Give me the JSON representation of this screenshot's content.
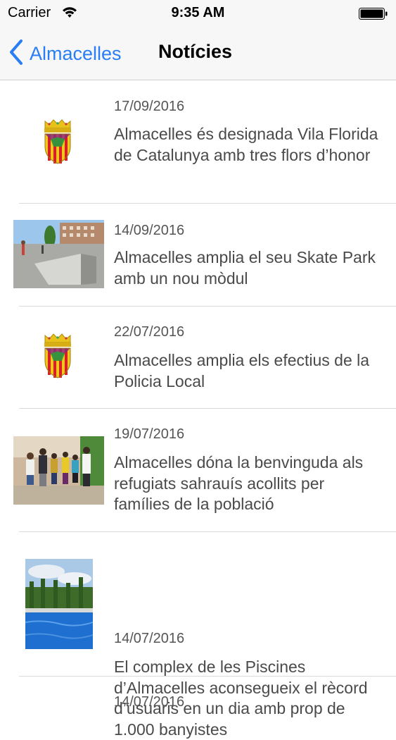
{
  "status_bar": {
    "carrier": "Carrier",
    "time": "9:35 AM"
  },
  "nav": {
    "back_label": "Almacelles",
    "title": "Notícies"
  },
  "news": [
    {
      "date": "17/09/2016",
      "title": "Almacelles és designada Vila Florida de Catalunya amb tres flors d’honor",
      "thumb": "coat-of-arms"
    },
    {
      "date": "14/09/2016",
      "title": "Almacelles amplia el seu Skate Park amb un nou mòdul",
      "thumb": "skate-park-photo"
    },
    {
      "date": "22/07/2016",
      "title": "Almacelles amplia els efectius de la Policia Local",
      "thumb": "coat-of-arms"
    },
    {
      "date": "19/07/2016",
      "title": "Almacelles dóna la benvinguda als refugiats sahrauís acollits per famílies de la població",
      "thumb": "group-photo"
    },
    {
      "date": "14/07/2016",
      "title": "El complex de les Piscines d’Almacelles aconsegueix el rècord d’usuaris en un dia amb prop de 1.000 banyistes",
      "thumb": "pool-photo"
    },
    {
      "date": "14/07/2016",
      "title": "",
      "thumb": ""
    }
  ],
  "colors": {
    "accent": "#2a7ef5",
    "separator": "#dadadd",
    "bar_background": "#f7f7f7"
  }
}
